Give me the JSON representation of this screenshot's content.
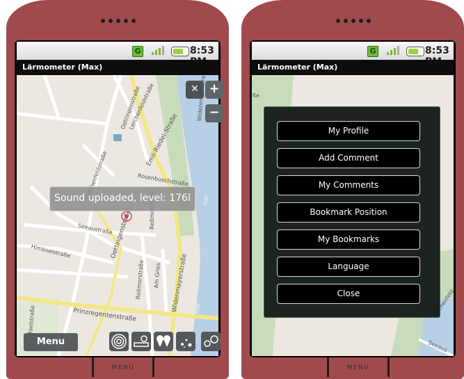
{
  "status": {
    "network": "G",
    "time": "8:53 PM"
  },
  "app": {
    "title": "Lärmometer (Max)"
  },
  "left_screen": {
    "toast": "Sound uploaded, level: 176l",
    "menu_button": "Menu",
    "zoom_in": "+",
    "zoom_out": "−",
    "map_labels": [
      "Oettingenstraße",
      "Lerchenfeldstraße",
      "Emil-Riedel-Straße",
      "Widenmayerstraße",
      "Rosenbuschstraße",
      "Lerchenfeldstraße",
      "Seeaustraße",
      "Himbselstraße",
      "Oettingenstraße",
      "Reitmorstraße",
      "Reitmorstraße",
      "Am Gries",
      "Widenmayerstraße",
      "Prinzregentenstraße",
      "Isar",
      "Isar",
      "Raffaelstraße"
    ]
  },
  "right_screen": {
    "map_labels": [
      "ße",
      "Lerchenfeld",
      "Seeaus"
    ],
    "menu_options": [
      "My Profile",
      "Add Comment",
      "My Comments",
      "Bookmark Position",
      "My Bookmarks",
      "Language",
      "Close"
    ]
  },
  "hardware": {
    "menu_key": "MENU"
  }
}
